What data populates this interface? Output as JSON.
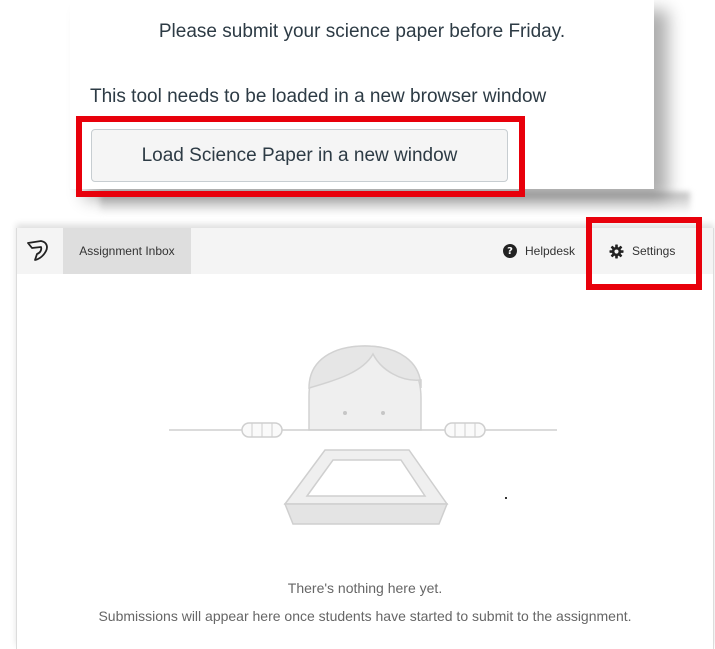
{
  "notice": {
    "line1": "Please submit your science paper before Friday.",
    "line2": "This tool needs to be loaded in a new browser window",
    "load_button_label": "Load Science Paper in a new window"
  },
  "toolbar": {
    "logo_icon": "turnitin-logo-icon",
    "tab_label": "Assignment Inbox",
    "help_icon": "question-circle-icon",
    "help_label": "Helpdesk",
    "settings_icon": "gear-icon",
    "settings_label": "Settings"
  },
  "empty_state": {
    "illustration": "empty-inbox-illustration",
    "title": "There's nothing here yet.",
    "message": "Submissions will appear here once students have started to submit to the assignment."
  },
  "colors": {
    "highlight": "#e8000b",
    "text_dark": "#2d3b45",
    "toolbar_bg": "#f4f4f4",
    "tab_active_bg": "#dedede",
    "illustration_fill": "#efefef",
    "illustration_stroke": "#cfcfcf"
  }
}
